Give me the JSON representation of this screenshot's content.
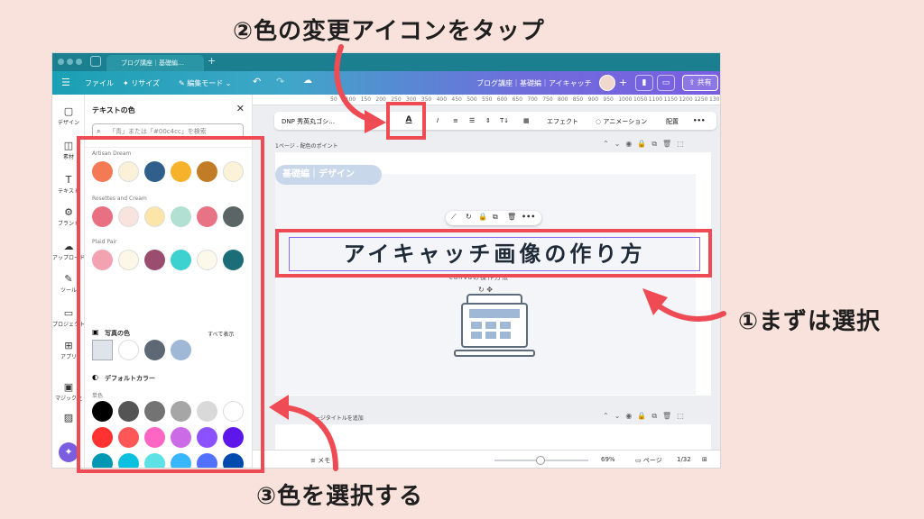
{
  "annotations": {
    "step2": "②色の変更アイコンをタップ",
    "step1": "①まずは選択",
    "step3": "③色を選択する"
  },
  "browser": {
    "tab_label": "ブログ講座｜基礎編…",
    "new_tab": "+"
  },
  "topbar": {
    "file": "ファイル",
    "resize": "リサイズ",
    "edit_mode": "編集モード",
    "doc_title": "ブログ講座｜基礎編｜アイキャッチ",
    "share": "共有"
  },
  "rail": [
    {
      "icon": "▢",
      "label": "デザイン"
    },
    {
      "icon": "◫",
      "label": "素材"
    },
    {
      "icon": "T",
      "label": "テキスト"
    },
    {
      "icon": "⚙",
      "label": "ブランド"
    },
    {
      "icon": "☁",
      "label": "アップロード"
    },
    {
      "icon": "✎",
      "label": "ツール"
    },
    {
      "icon": "▭",
      "label": "プロジェクト"
    },
    {
      "icon": "⊞",
      "label": "アプリ"
    },
    {
      "icon": "▣",
      "label": "マジック生"
    },
    {
      "icon": "▨",
      "label": ""
    }
  ],
  "panel": {
    "title": "テキストの色",
    "search_placeholder": "「青」または「#00c4cc」を検索",
    "palettes": [
      {
        "name": "Artisan Dream",
        "colors": [
          "#f47a55",
          "#fbf1d9",
          "#2f5f8a",
          "#f6b22b",
          "#c37c26",
          "#fbf2d7"
        ]
      },
      {
        "name": "Rosettes and Cream",
        "colors": [
          "#e96f83",
          "#f8e3de",
          "#fbe5a8",
          "#b2e0d2",
          "#e77385",
          "#5b6566"
        ]
      },
      {
        "name": "Plaid Pair",
        "colors": [
          "#f2a2b0",
          "#fdf7e7",
          "#9b4d6f",
          "#3dd1cf",
          "#fdf9ea",
          "#1b6e78"
        ]
      }
    ],
    "photo_section": "写真の色",
    "show_all": "すべて表示",
    "photo_colors": [
      "#ffffff",
      "#5e6874",
      "#9fb8d6"
    ],
    "default_section": "デフォルトカラー",
    "solid_label": "単色",
    "default_colors": [
      [
        "#000000",
        "#545454",
        "#737373",
        "#a6a6a6",
        "#d9d9d9",
        "#ffffff"
      ],
      [
        "#ff3131",
        "#ff5757",
        "#ff66c4",
        "#cb6ce6",
        "#8c52ff",
        "#5e17eb"
      ],
      [
        "#0097b2",
        "#0cc0df",
        "#5ce1e6",
        "#38b6ff",
        "#5271ff",
        "#004aad"
      ],
      [
        "#00bf63",
        "#7ed957",
        "#c1ff72",
        "#ffde59",
        "#ffbd59",
        "#ff914d"
      ]
    ]
  },
  "ruler": [
    "50",
    "100",
    "150",
    "200",
    "250",
    "300",
    "350",
    "400",
    "450",
    "500",
    "550",
    "600",
    "650",
    "700",
    "750",
    "800",
    "850",
    "900",
    "950",
    "1000",
    "1050",
    "1100",
    "1150",
    "1200",
    "1250",
    "1300"
  ],
  "toolbar": {
    "font": "DNP 秀英丸ゴシ…",
    "effect": "エフェクト",
    "animation": "アニメーション",
    "position": "配置"
  },
  "page1": {
    "header": "1ページ - 配色のポイント",
    "bubble": "基礎編｜デザイン",
    "headline": "アイキャッチ画像の作り方",
    "subtext": "canvaの操作方法"
  },
  "page2": {
    "header": "ページタイトルを追加"
  },
  "bottombar": {
    "memo": "メモ",
    "zoom": "69%",
    "pages": "ページ",
    "page_count": "1/32"
  }
}
